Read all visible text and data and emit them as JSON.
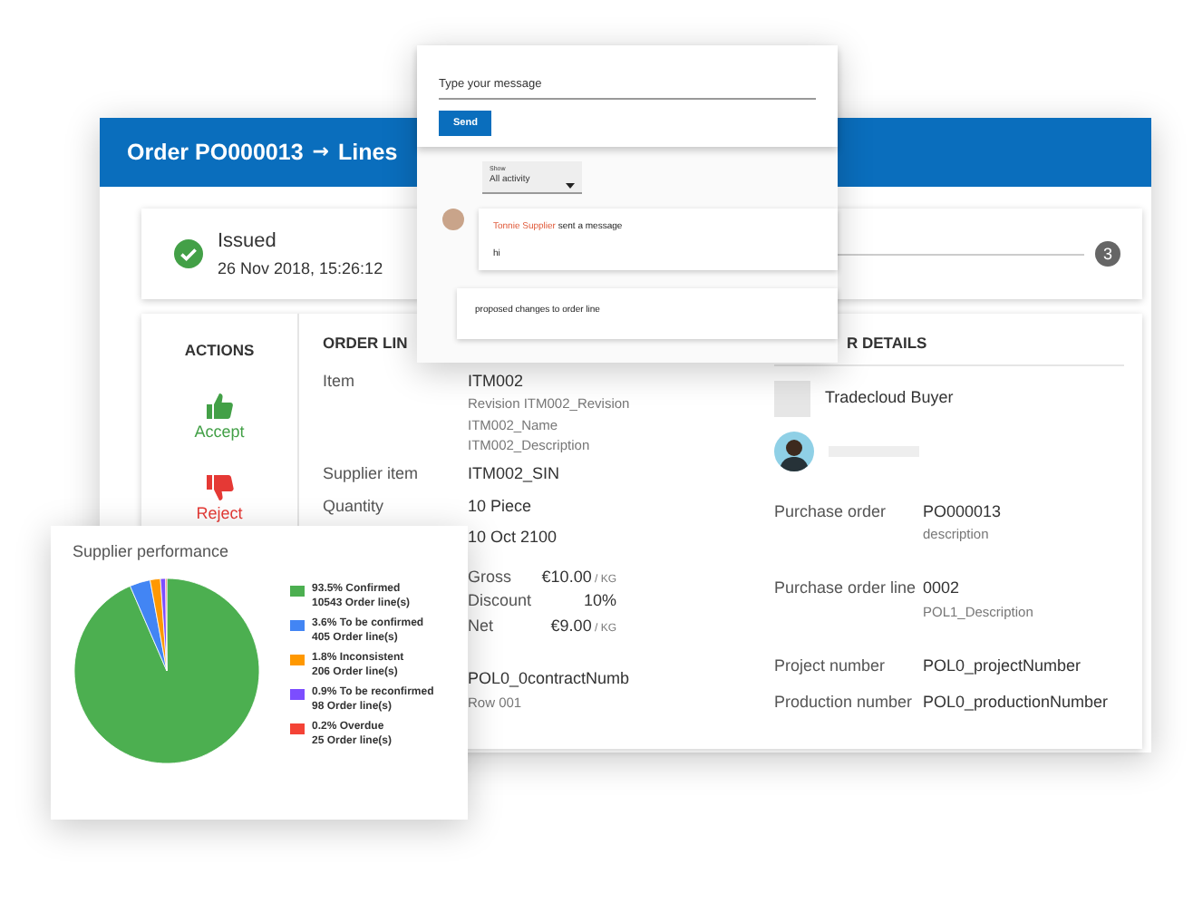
{
  "header": {
    "order": "Order PO000013",
    "arrow": "→",
    "section": "Lines"
  },
  "status": {
    "label": "Issued",
    "date": "26 Nov 2018, 15:26:12",
    "done": true,
    "step": "3"
  },
  "actions": {
    "title": "ACTIONS",
    "items": [
      {
        "kind": "accept",
        "label": "Accept"
      },
      {
        "kind": "reject",
        "label": "Reject"
      }
    ]
  },
  "order_line": {
    "title": "ORDER LIN",
    "fields": [
      {
        "label": "Item",
        "value": "ITM002",
        "notes": [
          "Revision ITM002_Revision",
          "ITM002_Name",
          "ITM002_Description"
        ]
      },
      {
        "label": "Supplier item",
        "value": "ITM002_SIN"
      },
      {
        "label": "Quantity",
        "value": "10 Piece"
      },
      {
        "value": "10 Oct 2100"
      }
    ],
    "prices": [
      {
        "label": "Gross",
        "amount": "€10.00",
        "unit": "/ KG"
      },
      {
        "label": "Discount",
        "amount": "10%"
      },
      {
        "label": "Net",
        "amount": "€9.00",
        "unit": "/ KG"
      }
    ],
    "contract": {
      "value": "POL0_0contractNumb",
      "note": "Row 001"
    }
  },
  "order_details": {
    "title": "R DETAILS",
    "company": "Tradecloud Buyer",
    "fields": [
      {
        "label": "Purchase order",
        "value": "PO000013",
        "note": "description"
      },
      {
        "label": "Purchase order line",
        "value": "0002",
        "note": "POL1_Description"
      },
      {
        "label": "Project number",
        "value": "POL0_projectNumber"
      },
      {
        "label": "Production number",
        "value": "POL0_productionNumber"
      }
    ]
  },
  "chat": {
    "placeholder": "Type your message",
    "send": "Send",
    "filter": {
      "label": "Show",
      "value": "All activity"
    },
    "events": [
      {
        "kind": "message",
        "author": "Tonnie Supplier",
        "action": "sent a message",
        "text": "hi"
      },
      {
        "kind": "change",
        "text": "proposed changes to order line"
      }
    ]
  },
  "performance": {
    "title": "Supplier performance",
    "legend": [
      {
        "percent": "93.5%",
        "count": "10543",
        "color": "#4caf50"
      },
      {
        "percent": "3.6%",
        "count": "405",
        "color": "#4285f4"
      },
      {
        "percent": "1.8%",
        "count": "206",
        "color": "#ff9800"
      },
      {
        "percent": "0.9%",
        "count": "98",
        "color": "#7c4dff"
      },
      {
        "percent": "0.2%",
        "count": "25",
        "color": "#f44336"
      }
    ],
    "chart_data": {
      "type": "pie",
      "categories": [
        "Confirmed",
        "To be confirmed",
        "Inconsistent",
        "To be reconfirmed",
        "Overdue"
      ],
      "series": [
        {
          "name": "Order line(s)",
          "values": [
            93.5,
            3.6,
            1.8,
            0.9,
            0.2
          ]
        }
      ]
    }
  }
}
